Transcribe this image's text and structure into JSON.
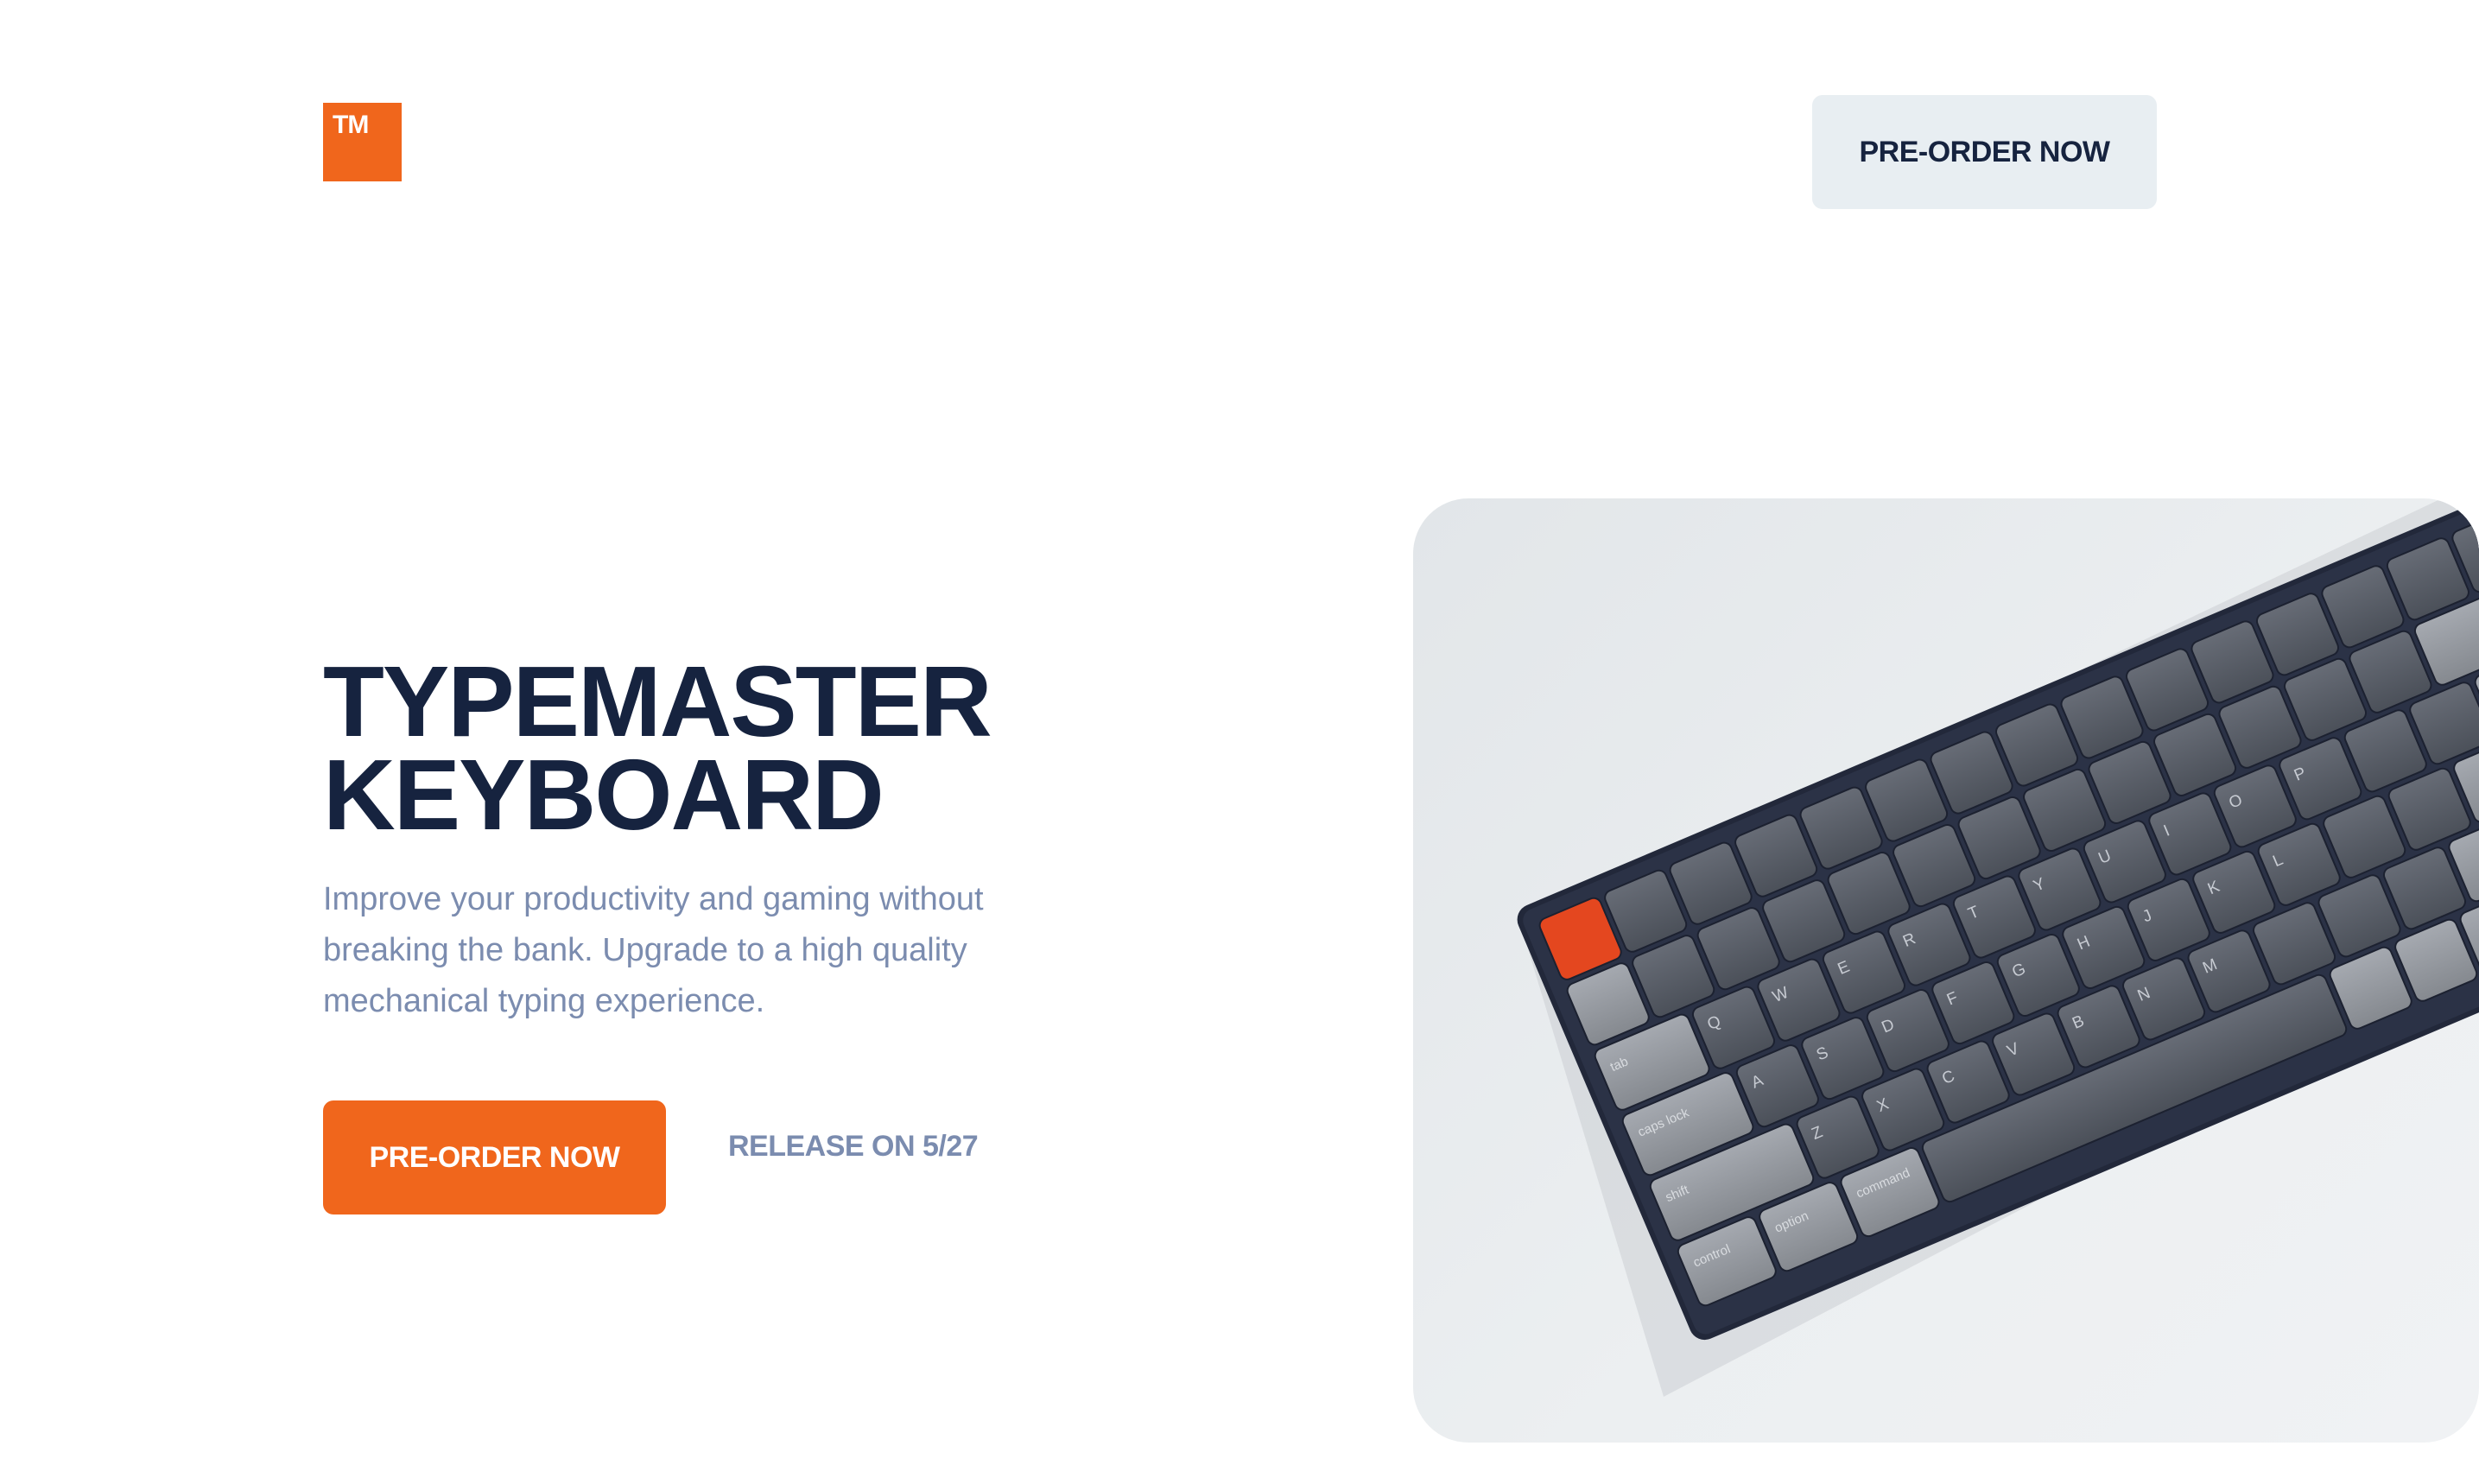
{
  "header": {
    "logo_text": "TM",
    "preorder_label": "PRE-ORDER NOW"
  },
  "hero": {
    "title_line1": "TYPEMASTER",
    "title_line2": "KEYBOARD",
    "description": "Improve your productivity and gaming without breaking the bank. Upgrade to a high quality mechanical typing experience.",
    "cta_label": "PRE-ORDER NOW",
    "release_text": "RELEASE ON 5/27"
  },
  "colors": {
    "accent": "#f0661c",
    "navy": "#16233f",
    "muted": "#7b8caf",
    "header_button_bg": "#e8eef2"
  },
  "image": {
    "subject": "mechanical-keyboard-photo",
    "key_legends": [
      "tab",
      "caps lock",
      "shift",
      "control",
      "option",
      "command",
      "Q",
      "W",
      "E",
      "R",
      "T",
      "Y",
      "U",
      "I",
      "O",
      "P",
      "A",
      "S",
      "D",
      "F",
      "G",
      "H",
      "J",
      "K",
      "L",
      "Z",
      "X",
      "C",
      "V",
      "B",
      "N",
      "M"
    ]
  }
}
